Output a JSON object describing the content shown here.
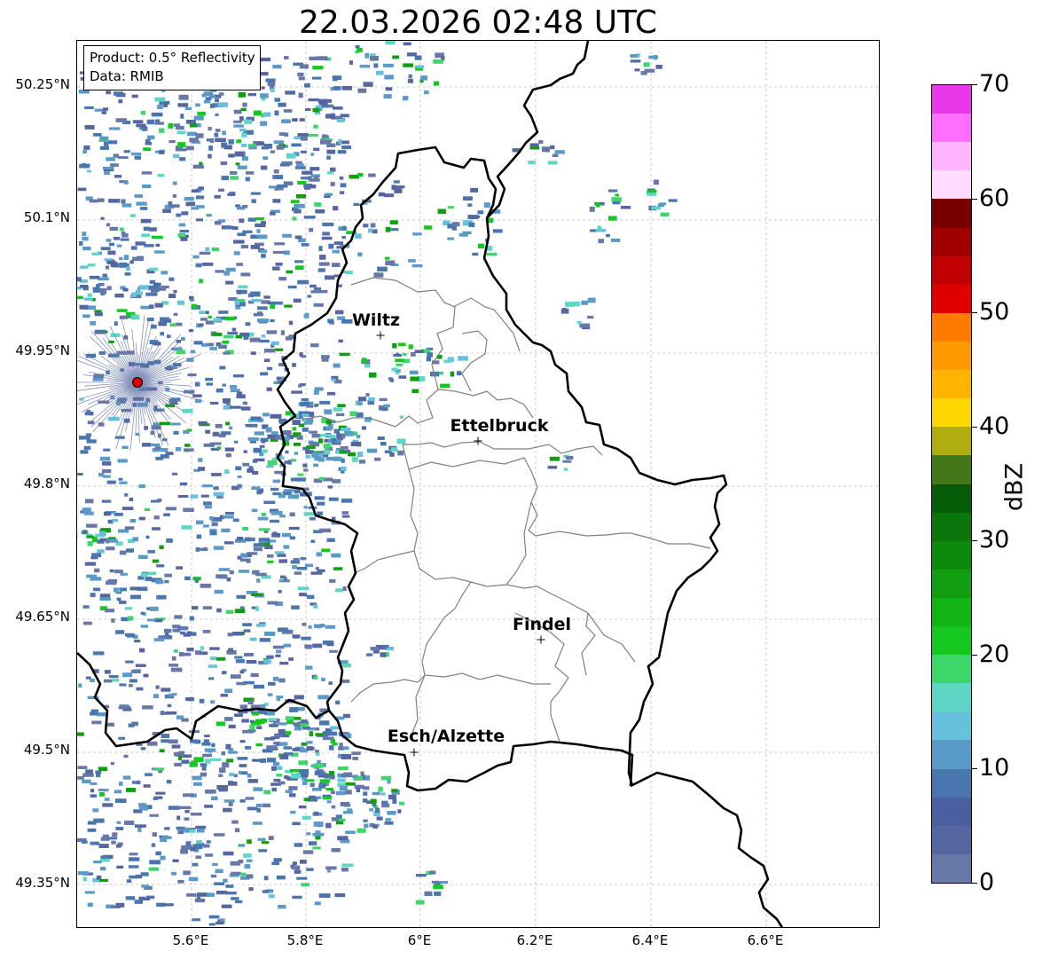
{
  "title": "22.03.2026 02:48 UTC",
  "info": {
    "product": "Product: 0.5° Reflectivity",
    "source": "Data: RMIB"
  },
  "y_ticks": [
    "50.25°N",
    "50.1°N",
    "49.95°N",
    "49.8°N",
    "49.65°N",
    "49.5°N",
    "49.35°N"
  ],
  "x_ticks": [
    "5.6°E",
    "5.8°E",
    "6°E",
    "6.2°E",
    "6.4°E",
    "6.6°E"
  ],
  "cities": [
    "Wiltz",
    "Ettelbruck",
    "Findel",
    "Esch/Alzette"
  ],
  "colorbar": {
    "title": "dBZ",
    "tick_labels": [
      "0",
      "10",
      "20",
      "30",
      "40",
      "50",
      "60",
      "70"
    ],
    "colors": [
      "#6778a8",
      "#5566a0",
      "#4a5ea0",
      "#4a76b0",
      "#5a9ac8",
      "#66c2dc",
      "#5ed6c6",
      "#3ed66a",
      "#14c820",
      "#10b414",
      "#109e10",
      "#0c8a0c",
      "#0a760c",
      "#065c06",
      "#44771a",
      "#aeae10",
      "#ffd700",
      "#ffb400",
      "#ff9a00",
      "#ff7c00",
      "#e00000",
      "#c00000",
      "#a00000",
      "#7a0000",
      "#ffdcff",
      "#ffb4ff",
      "#ff6eff",
      "#e838ea"
    ]
  }
}
